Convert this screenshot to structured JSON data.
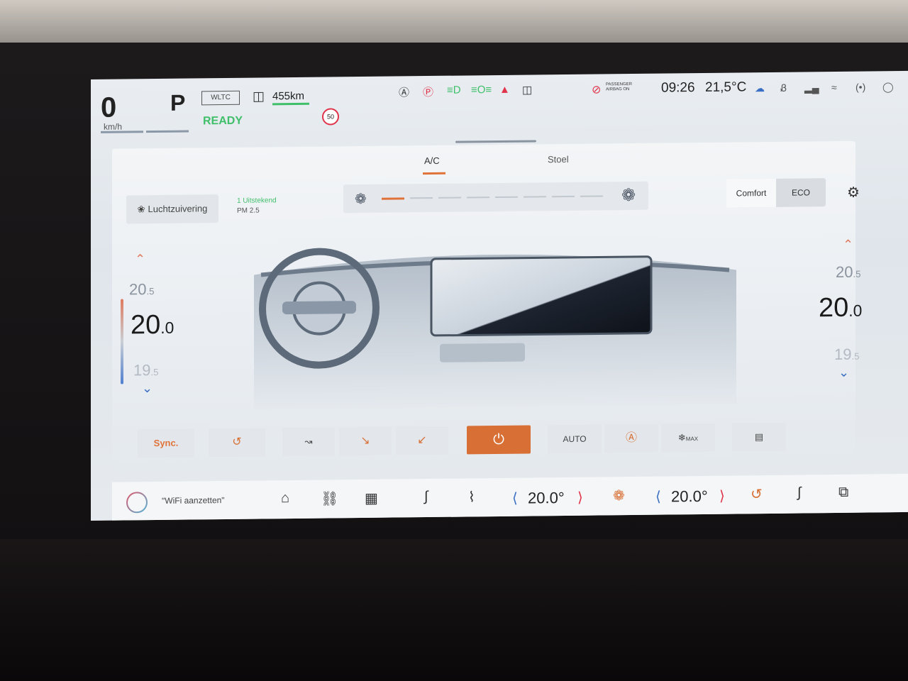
{
  "status": {
    "speed": "0",
    "speed_unit": "km/h",
    "gear": "P",
    "range_mode": "WLTC",
    "ready": "READY",
    "range": "455km",
    "speed_limit": "50",
    "airbag_line1": "PASSENGER",
    "airbag_line2": "AIRBAG ON",
    "time": "09:26",
    "outside_temp": "21,5°C"
  },
  "tabs": [
    {
      "label": "A/C",
      "active": true
    },
    {
      "label": "Stoel",
      "active": false
    }
  ],
  "purification": {
    "label": "Luchtzuivering",
    "air_quality": "1 Uitstekend",
    "pm": "PM 2.5"
  },
  "fan": {
    "level": 1,
    "max": 8
  },
  "modes": {
    "comfort": "Comfort",
    "eco": "ECO",
    "selected": "Comfort"
  },
  "left_temp": {
    "above": "20",
    "above_dec": ".5",
    "current": "20",
    "current_dec": ".0",
    "below": "19",
    "below_dec": ".5"
  },
  "right_temp": {
    "above": "20",
    "above_dec": ".5",
    "current": "20",
    "current_dec": ".0",
    "below": "19",
    "below_dec": ".5"
  },
  "controls": {
    "sync": "Sync.",
    "auto": "AUTO",
    "max_label": "MAX"
  },
  "dock": {
    "assistant_hint": "\"WiFi aanzetten\"",
    "driver_temp": "20.0°",
    "passenger_temp": "20.0°"
  },
  "colors": {
    "accent": "#d86f34",
    "ready_green": "#3fbf6a",
    "warm": "#e07a5f",
    "cool": "#3a6fc4"
  }
}
